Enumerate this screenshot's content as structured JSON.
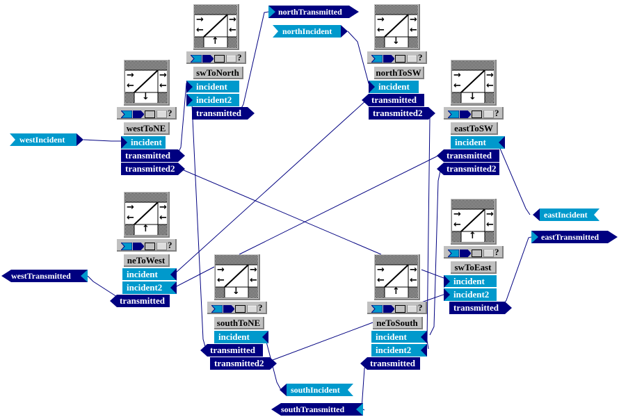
{
  "diagram": {
    "blocks": [
      {
        "id": "westToNE",
        "name": "westToNE",
        "arrow": "down",
        "ports": [
          {
            "label": "incident",
            "kind": "in",
            "side": "left"
          },
          {
            "label": "transmitted",
            "kind": "out",
            "side": "right"
          },
          {
            "label": "transmitted2",
            "kind": "out",
            "side": "right"
          }
        ]
      },
      {
        "id": "swToNorth",
        "name": "swToNorth",
        "arrow": "up",
        "ports": [
          {
            "label": "incident",
            "kind": "in",
            "side": "left"
          },
          {
            "label": "incident2",
            "kind": "in",
            "side": "left"
          },
          {
            "label": "transmitted",
            "kind": "out",
            "side": "right"
          }
        ]
      },
      {
        "id": "northToSW",
        "name": "northToSW",
        "arrow": "down",
        "ports": [
          {
            "label": "incident",
            "kind": "in",
            "side": "left"
          },
          {
            "label": "transmitted",
            "kind": "out",
            "side": "left"
          },
          {
            "label": "transmitted2",
            "kind": "out",
            "side": "right"
          }
        ]
      },
      {
        "id": "eastToSW",
        "name": "eastToSW",
        "arrow": "down",
        "ports": [
          {
            "label": "incident",
            "kind": "in",
            "side": "right"
          },
          {
            "label": "transmitted",
            "kind": "out",
            "side": "left"
          },
          {
            "label": "transmitted2",
            "kind": "out",
            "side": "left"
          }
        ]
      },
      {
        "id": "neToWest",
        "name": "neToWest",
        "arrow": "up",
        "ports": [
          {
            "label": "incident",
            "kind": "in",
            "side": "right"
          },
          {
            "label": "incident2",
            "kind": "in",
            "side": "right"
          },
          {
            "label": "transmitted",
            "kind": "out",
            "side": "left"
          }
        ]
      },
      {
        "id": "southToNE",
        "name": "southToNE",
        "arrow": "down",
        "ports": [
          {
            "label": "incident",
            "kind": "in",
            "side": "right"
          },
          {
            "label": "transmitted",
            "kind": "out",
            "side": "left"
          },
          {
            "label": "transmitted2",
            "kind": "out",
            "side": "right"
          }
        ]
      },
      {
        "id": "neToSouth",
        "name": "neToSouth",
        "arrow": "up",
        "ports": [
          {
            "label": "incident",
            "kind": "in",
            "side": "right"
          },
          {
            "label": "incident2",
            "kind": "in",
            "side": "right"
          },
          {
            "label": "transmitted",
            "kind": "out",
            "side": "left"
          }
        ]
      },
      {
        "id": "swToEast",
        "name": "swToEast",
        "arrow": "up",
        "ports": [
          {
            "label": "incident",
            "kind": "in",
            "side": "left"
          },
          {
            "label": "incident2",
            "kind": "in",
            "side": "left"
          },
          {
            "label": "transmitted",
            "kind": "out",
            "side": "right"
          }
        ]
      }
    ],
    "external_ports": [
      {
        "id": "northTransmitted",
        "label": "northTransmitted",
        "kind": "out",
        "direction": "right"
      },
      {
        "id": "northIncident",
        "label": "northIncident",
        "kind": "in",
        "direction": "right"
      },
      {
        "id": "westIncident",
        "label": "westIncident",
        "kind": "in",
        "direction": "right"
      },
      {
        "id": "westTransmitted",
        "label": "westTransmitted",
        "kind": "out",
        "direction": "left"
      },
      {
        "id": "eastIncident",
        "label": "eastIncident",
        "kind": "in",
        "direction": "left"
      },
      {
        "id": "eastTransmitted",
        "label": "eastTransmitted",
        "kind": "out",
        "direction": "right"
      },
      {
        "id": "southIncident",
        "label": "southIncident",
        "kind": "in",
        "direction": "left"
      },
      {
        "id": "southTransmitted",
        "label": "southTransmitted",
        "kind": "out",
        "direction": "left"
      }
    ],
    "toolbar_icons": [
      "input-port-icon",
      "output-port-icon",
      "io-port-icon",
      "parameter-port-icon",
      "help-icon"
    ],
    "toolbar_help_label": "?",
    "icon_arrows": {
      "right": "→",
      "left": "←",
      "up": "↑",
      "down": "↓"
    },
    "colors": {
      "input_port": "#0099cc",
      "output_port": "#000080",
      "wire": "#000080",
      "block_gray": "#c0c0c0"
    },
    "connections": [
      [
        "westIncident",
        "westToNE.incident"
      ],
      [
        "westToNE.transmitted",
        "swToNorth.incident"
      ],
      [
        "westToNE.transmitted2",
        "neToSouth.incident_icon"
      ],
      [
        "swToNorth.transmitted",
        "northTransmitted"
      ],
      [
        "northIncident",
        "northToSW.incident"
      ],
      [
        "northToSW.transmitted",
        "neToWest.incident"
      ],
      [
        "northToSW.transmitted2",
        "neToSouth.incident2"
      ],
      [
        "eastIncident",
        "eastToSW.incident"
      ],
      [
        "eastToSW.transmitted",
        "southToNE.icon"
      ],
      [
        "eastToSW.transmitted2",
        "neToSouth.incident"
      ],
      [
        "neToWest.transmitted",
        "westTransmitted"
      ],
      [
        "southToNE.icon",
        "neToWest.incident2"
      ],
      [
        "southIncident",
        "southToNE.incident"
      ],
      [
        "southToNE.transmitted",
        "swToNorth.incident2"
      ],
      [
        "southToNE.transmitted2",
        "neToSouth.name"
      ],
      [
        "neToSouth.icon",
        "swToEast.incident"
      ],
      [
        "neToSouth.toolbar",
        "swToEast.incident2"
      ],
      [
        "neToSouth.transmitted",
        "southTransmitted"
      ],
      [
        "swToEast.transmitted",
        "eastTransmitted"
      ]
    ]
  }
}
